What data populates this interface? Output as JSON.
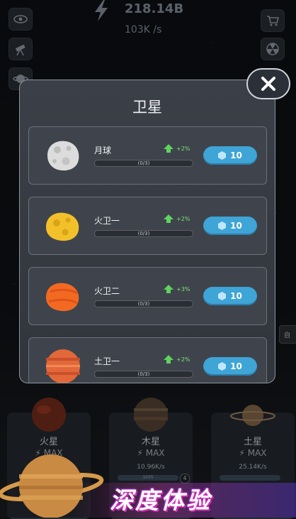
{
  "header": {
    "total": "218.14B",
    "rate": "103K /s"
  },
  "left_buttons": [
    "eye-icon",
    "telescope-icon",
    "planet-icon"
  ],
  "right_buttons": [
    "cart-icon",
    "radiation-icon"
  ],
  "modal": {
    "title": "卫星",
    "close_icon": "close-icon",
    "satellites": [
      {
        "name": "月球",
        "bonus": "+2%",
        "progress": "(0/3)",
        "price": "10",
        "color": "#e3e3e3"
      },
      {
        "name": "火卫一",
        "bonus": "+2%",
        "progress": "(0/3)",
        "price": "10",
        "color": "#f3c62f"
      },
      {
        "name": "火卫二",
        "bonus": "+3%",
        "progress": "(0/3)",
        "price": "10",
        "color": "#f26a24"
      },
      {
        "name": "土卫一",
        "bonus": "+2%",
        "progress": "(0/3)",
        "price": "10",
        "color": "#e46a3a"
      }
    ]
  },
  "side_tab": "自",
  "planets": [
    {
      "name": "火星",
      "max": "MAX",
      "rate": "",
      "level": ""
    },
    {
      "name": "木星",
      "max": "MAX",
      "rate": "10.96K/s",
      "bar": "1035",
      "level": "4"
    },
    {
      "name": "土星",
      "max": "MAX",
      "rate": "25.14K/s",
      "bar": "",
      "level": ""
    }
  ],
  "banner": "深度体验",
  "colors": {
    "accent": "#3fa4d6",
    "bonus_green": "#5fd35f",
    "modal_border": "#8c949e"
  }
}
